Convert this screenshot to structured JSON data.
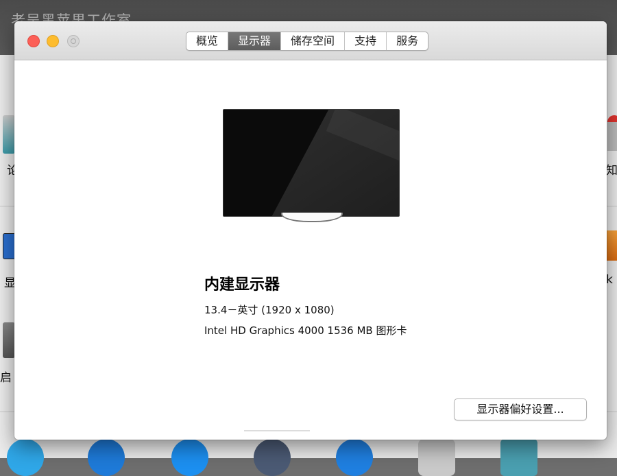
{
  "watermark": "老吴黑苹果工作室",
  "window": {
    "tabs": [
      {
        "label": "概览",
        "active": false
      },
      {
        "label": "显示器",
        "active": true
      },
      {
        "label": "储存空间",
        "active": false
      },
      {
        "label": "支持",
        "active": false
      },
      {
        "label": "服务",
        "active": false
      }
    ]
  },
  "display": {
    "name": "内建显示器",
    "size": "13.4－英寸 (1920 x 1080)",
    "graphics": "Intel HD Graphics 4000 1536 MB 图形卡"
  },
  "buttons": {
    "preferences": "显示器偏好设置..."
  },
  "background_fragments": {
    "left_1": "论",
    "left_2": "显",
    "left_3": "启",
    "right_1": "知",
    "right_2": "k"
  },
  "colors": {
    "close": "#fc5f57",
    "minimize": "#fdbc2e",
    "active_tab": "#5c5c5c"
  }
}
